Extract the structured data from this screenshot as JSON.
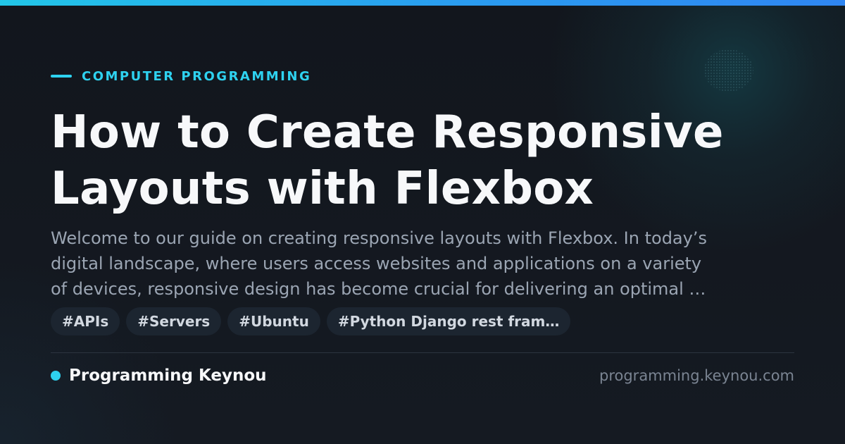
{
  "colors": {
    "accent": "#2ed2f0",
    "background": "#13171f",
    "title": "#f7f8fa",
    "excerpt": "#9ba5b3",
    "tag_bg": "#1c2530",
    "tag_text": "#d2d8e0",
    "domain_text": "#7a8492"
  },
  "category": {
    "label": "COMPUTER PROGRAMMING",
    "icon": "dash-icon"
  },
  "title": {
    "lines": [
      "How to Create Responsive",
      "Layouts with Flexbox"
    ]
  },
  "excerpt": {
    "lines": [
      "Welcome to our guide on creating responsive layouts with Flexbox. In today’s",
      "digital landscape, where users access websites and applications on a variety",
      "of devices, responsive design has become crucial for delivering an optimal …"
    ]
  },
  "tags": [
    {
      "label": "#APIs"
    },
    {
      "label": "#Servers"
    },
    {
      "label": "#Ubuntu"
    },
    {
      "label": "#Python Django rest fram…"
    }
  ],
  "footer": {
    "brand_name": "Programming Keynou",
    "brand_icon": "dot-icon",
    "domain": "programming.keynou.com"
  }
}
